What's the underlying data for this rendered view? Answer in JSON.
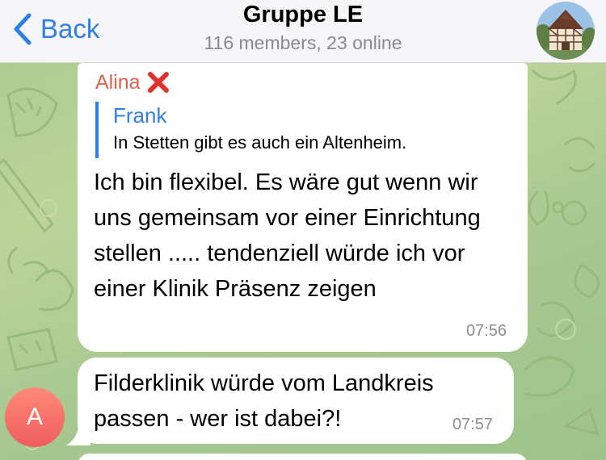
{
  "header": {
    "back_label": "Back",
    "title": "Gruppe LE",
    "subtitle": "116 members, 23 online",
    "back_icon": "chevron-left-icon",
    "avatar_icon": "group-photo-house"
  },
  "messages": [
    {
      "sender": "Alina",
      "sender_icon": "red-cross-icon",
      "reply": {
        "name": "Frank",
        "text": "In Stetten gibt es auch ein Altenheim."
      },
      "text": "Ich bin flexibel. Es wäre gut wenn wir uns gemeinsam vor einer Einrichtung stellen ..... tendenziell würde ich vor einer Klinik Präsenz zeigen",
      "time": "07:56"
    },
    {
      "text": "Filderklinik würde vom Landkreis passen - wer ist dabei?!",
      "time": "07:57",
      "avatar_letter": "A"
    }
  ],
  "colors": {
    "accent": "#2f7fe6",
    "sender_name": "#e0634f",
    "avatar": "#ef5d60",
    "background": "#b3cf95"
  }
}
